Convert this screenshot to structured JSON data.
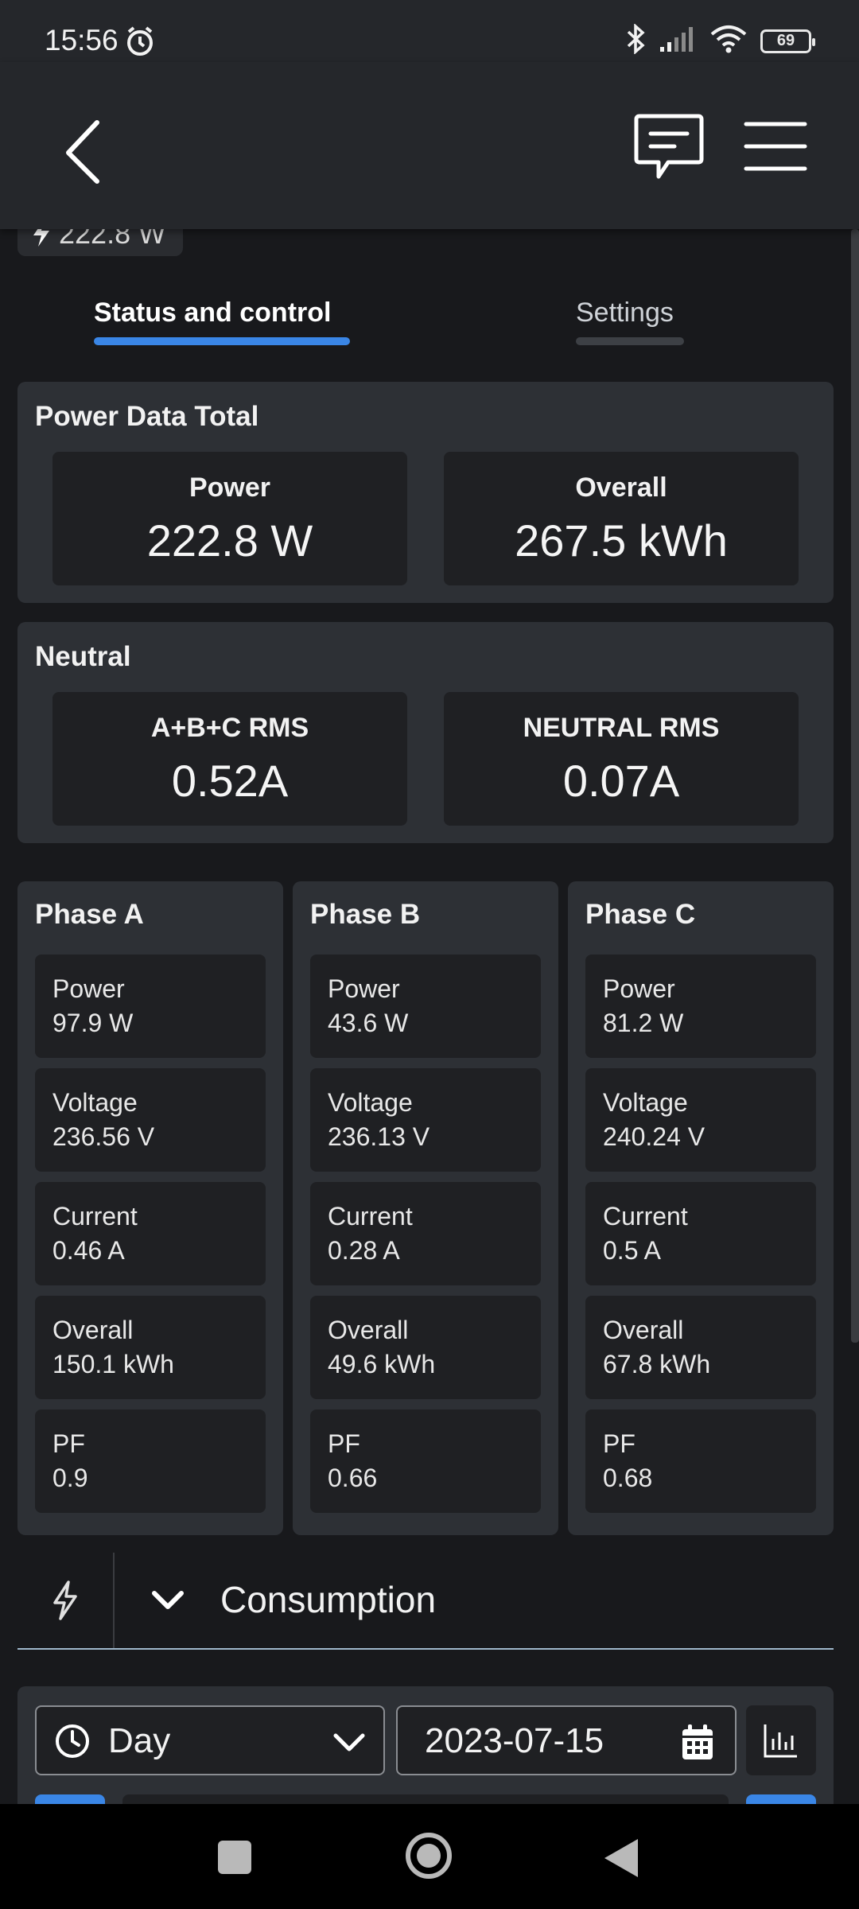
{
  "status_bar": {
    "time": "15:56",
    "battery": "69"
  },
  "app_bar": {
    "back_icon": "chevron-left-icon",
    "chat_icon": "chat-bubble-icon",
    "menu_icon": "hamburger-menu-icon"
  },
  "header_chip": {
    "icon": "bolt-icon",
    "value": "222.8 W"
  },
  "tabs": [
    {
      "label": "Status and control",
      "active": true
    },
    {
      "label": "Settings",
      "active": false
    }
  ],
  "power_total": {
    "title": "Power Data Total",
    "power": {
      "label": "Power",
      "value": "222.8 W"
    },
    "overall": {
      "label": "Overall",
      "value": "267.5 kWh"
    }
  },
  "neutral": {
    "title": "Neutral",
    "abc_rms": {
      "label": "A+B+C RMS",
      "value": "0.52A"
    },
    "neutral_rms": {
      "label": "NEUTRAL RMS",
      "value": "0.07A"
    }
  },
  "phases": [
    {
      "title": "Phase A",
      "metrics": [
        {
          "label": "Power",
          "value": "97.9 W"
        },
        {
          "label": "Voltage",
          "value": "236.56 V"
        },
        {
          "label": "Current",
          "value": "0.46 A"
        },
        {
          "label": "Overall",
          "value": "150.1 kWh"
        },
        {
          "label": "PF",
          "value": "0.9"
        }
      ]
    },
    {
      "title": "Phase B",
      "metrics": [
        {
          "label": "Power",
          "value": "43.6 W"
        },
        {
          "label": "Voltage",
          "value": "236.13 V"
        },
        {
          "label": "Current",
          "value": "0.28 A"
        },
        {
          "label": "Overall",
          "value": "49.6 kWh"
        },
        {
          "label": "PF",
          "value": "0.66"
        }
      ]
    },
    {
      "title": "Phase C",
      "metrics": [
        {
          "label": "Power",
          "value": "81.2 W"
        },
        {
          "label": "Voltage",
          "value": "240.24 V"
        },
        {
          "label": "Current",
          "value": "0.5 A"
        },
        {
          "label": "Overall",
          "value": "67.8 kWh"
        },
        {
          "label": "PF",
          "value": "0.68"
        }
      ]
    }
  ],
  "consumption": {
    "title": "Consumption",
    "icon": "bolt-icon"
  },
  "filters": {
    "period": "Day",
    "date": "2023-07-15",
    "chart_icon": "bar-chart-icon"
  },
  "colors": {
    "accent": "#3a86e6",
    "background": "#18191c",
    "card": "#2d3035",
    "tile": "#1f2023"
  }
}
